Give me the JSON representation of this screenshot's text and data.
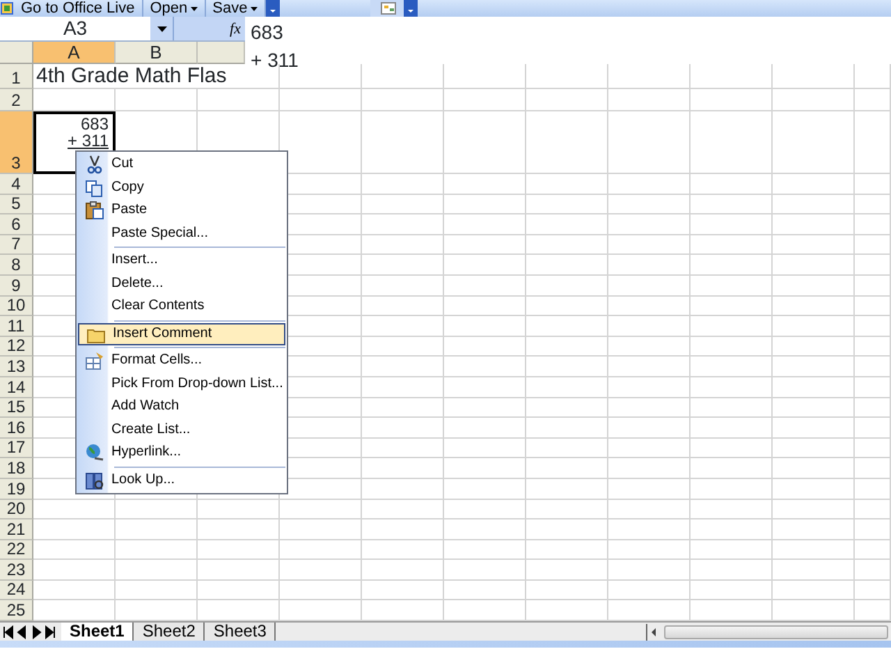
{
  "toolbar": {
    "buttons": [
      {
        "label": "Go to Office Live",
        "dropdown": false
      },
      {
        "label": "Open",
        "dropdown": true
      },
      {
        "label": "Save",
        "dropdown": true
      }
    ]
  },
  "formula_bar": {
    "name_box": "A3",
    "function_label": "fx",
    "formula_lines": [
      "683",
      "+ 311"
    ]
  },
  "columns": [
    {
      "label": "A",
      "selected": true
    },
    {
      "label": "B",
      "selected": false
    }
  ],
  "rows": [
    {
      "label": "1",
      "selected": false,
      "cell_a": "4th Grade Math Flas"
    },
    {
      "label": "2",
      "selected": false
    },
    {
      "label": "3",
      "selected": true,
      "cell_a_lines": [
        "683",
        "+ 311"
      ]
    },
    {
      "label": "4",
      "selected": false
    },
    {
      "label": "5",
      "selected": false
    },
    {
      "label": "6",
      "selected": false
    },
    {
      "label": "7",
      "selected": false
    },
    {
      "label": "8",
      "selected": false
    },
    {
      "label": "9",
      "selected": false
    },
    {
      "label": "10",
      "selected": false
    },
    {
      "label": "11",
      "selected": false
    },
    {
      "label": "12",
      "selected": false
    },
    {
      "label": "13",
      "selected": false
    },
    {
      "label": "14",
      "selected": false
    },
    {
      "label": "15",
      "selected": false
    },
    {
      "label": "16",
      "selected": false
    },
    {
      "label": "17",
      "selected": false
    },
    {
      "label": "18",
      "selected": false
    },
    {
      "label": "19",
      "selected": false
    },
    {
      "label": "20",
      "selected": false
    },
    {
      "label": "21",
      "selected": false
    },
    {
      "label": "22",
      "selected": false
    },
    {
      "label": "23",
      "selected": false
    },
    {
      "label": "24",
      "selected": false
    },
    {
      "label": "25",
      "selected": false
    }
  ],
  "context_menu": [
    {
      "label": "Cut",
      "separator_before": false,
      "selected": false
    },
    {
      "label": "Copy",
      "separator_before": false,
      "selected": false
    },
    {
      "label": "Paste",
      "separator_before": false,
      "selected": false
    },
    {
      "label": "Paste Special...",
      "separator_before": false,
      "selected": false
    },
    {
      "label": "Insert...",
      "separator_before": true,
      "selected": false
    },
    {
      "label": "Delete...",
      "separator_before": false,
      "selected": false
    },
    {
      "label": "Clear Contents",
      "separator_before": false,
      "selected": false
    },
    {
      "label": "Insert Comment",
      "separator_before": true,
      "selected": true
    },
    {
      "label": "Format Cells...",
      "separator_before": true,
      "selected": false
    },
    {
      "label": "Pick From Drop-down List...",
      "separator_before": false,
      "selected": false
    },
    {
      "label": "Add Watch",
      "separator_before": false,
      "selected": false
    },
    {
      "label": "Create List...",
      "separator_before": false,
      "selected": false
    },
    {
      "label": "Hyperlink...",
      "separator_before": false,
      "selected": false
    },
    {
      "label": "Look Up...",
      "separator_before": true,
      "selected": false
    }
  ],
  "sheet_tabs": [
    {
      "label": "Sheet1",
      "selected": true
    },
    {
      "label": "Sheet2",
      "selected": false
    },
    {
      "label": "Sheet3",
      "selected": false
    }
  ]
}
